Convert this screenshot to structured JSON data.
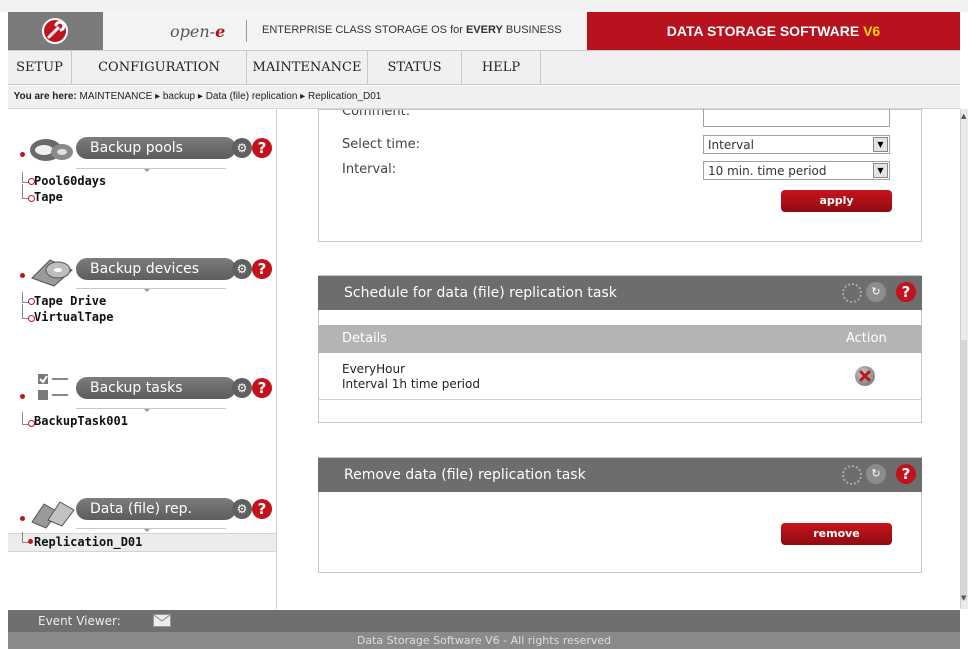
{
  "brand": {
    "name_prefix": "open-",
    "name_suffix": "e",
    "tagline_pre": "ENTERPRISE CLASS STORAGE OS for ",
    "tagline_bold": "EVERY",
    "tagline_post": " BUSINESS",
    "product_pre": "DATA STORAGE SOFTWARE ",
    "product_ver": "V6",
    "brand_color": "#b7121d"
  },
  "nav": {
    "items": [
      "SETUP",
      "CONFIGURATION",
      "MAINTENANCE",
      "STATUS",
      "HELP"
    ]
  },
  "breadcrumb": {
    "prefix": "You are here:",
    "path": "MAINTENANCE ▸ backup ▸ Data (file) replication ▸ Replication_D01"
  },
  "sidebar": {
    "sections": [
      {
        "title": "Backup pools",
        "icon": "disk-pool-icon",
        "items": [
          "Pool60days",
          "Tape"
        ]
      },
      {
        "title": "Backup devices",
        "icon": "tape-device-icon",
        "items": [
          "Tape Drive",
          "VirtualTape"
        ]
      },
      {
        "title": "Backup tasks",
        "icon": "task-list-icon",
        "items": [
          "BackupTask001"
        ]
      },
      {
        "title": "Data (file) rep.",
        "icon": "replication-icon",
        "items": [
          "Replication_D01"
        ]
      }
    ]
  },
  "settings_panel": {
    "comment_label": "Comment:",
    "select_time_label": "Select time:",
    "select_time_value": "Interval",
    "interval_label": "Interval:",
    "interval_value": "10 min. time period",
    "apply_label": "apply"
  },
  "schedule_panel": {
    "title": "Schedule for data (file) replication task",
    "col_details": "Details",
    "col_action": "Action",
    "row_line1": "EveryHour",
    "row_line2": "Interval 1h time period"
  },
  "remove_panel": {
    "title": "Remove data (file) replication task",
    "remove_label": "remove"
  },
  "footer": {
    "event_viewer": "Event Viewer:",
    "copyright": "Data Storage Software V6 - All rights reserved"
  }
}
